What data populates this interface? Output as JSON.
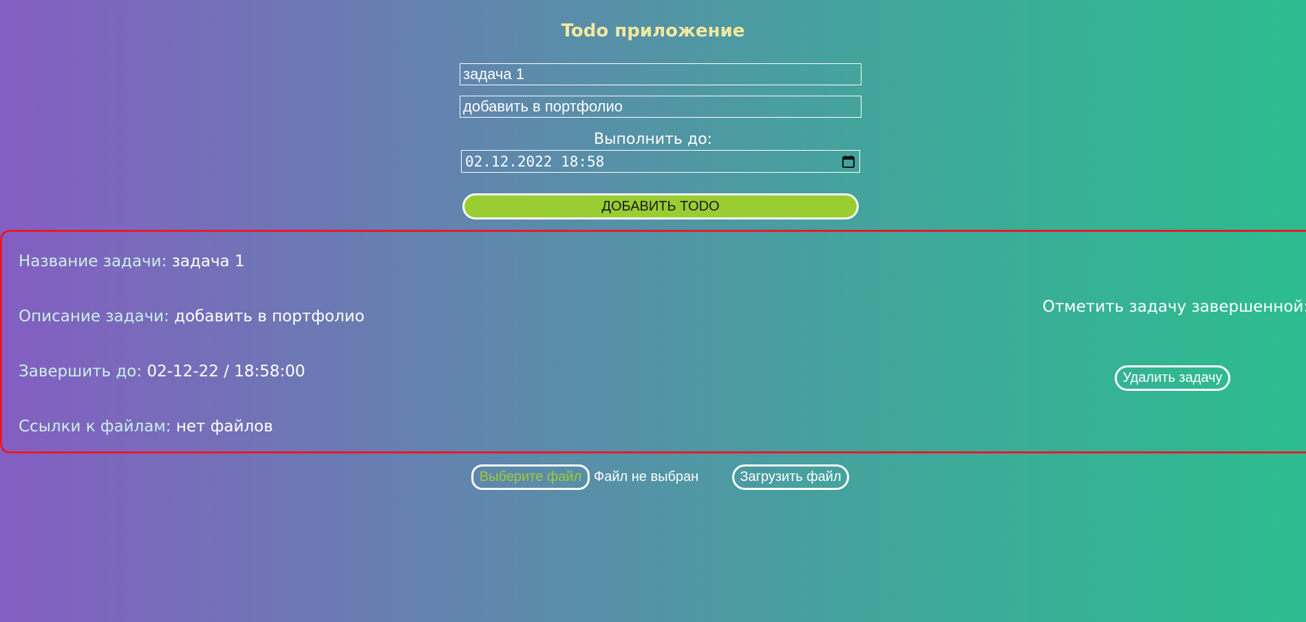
{
  "app": {
    "title": "Todo приложение"
  },
  "form": {
    "title_value": "задача 1",
    "description_value": "добавить в портфолио",
    "deadline_label": "Выполнить до:",
    "deadline_value": "02.12.2022 18:58",
    "add_button_label": "ДОБАВИТЬ TODO"
  },
  "todo": {
    "title_label": "Название задачи:",
    "title_value": "задача 1",
    "description_label": "Описание задачи:",
    "description_value": "добавить в портфолио",
    "deadline_label": "Завершить до:",
    "deadline_value": "02-12-22 / 18:58:00",
    "files_label": "Ссылки к файлам:",
    "files_value": "нет файлов",
    "complete_label": "Отметить задачу завершенной:",
    "complete_checked": false,
    "delete_button_label": "Удалить задачу"
  },
  "upload": {
    "choose_button_label": "Выберите файл",
    "file_status": "Файл не выбран",
    "upload_button_label": "Загрузить файл"
  },
  "colors": {
    "gradient_start": "#845ec2",
    "gradient_end": "#2cbd8f",
    "title_color": "#f5e8a0",
    "accent_green": "#9acd32",
    "card_border": "#e8192c",
    "label_color": "#c9f1e6"
  },
  "icons": {
    "calendar": "calendar-icon"
  }
}
